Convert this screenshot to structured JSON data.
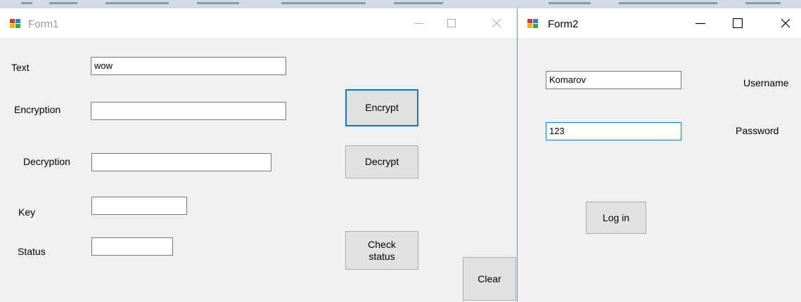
{
  "form1": {
    "title": "Form1",
    "labels": {
      "text": "Text",
      "encryption": "Encryption",
      "decryption": "Decryption",
      "key": "Key",
      "status": "Status"
    },
    "fields": {
      "text": "wow",
      "encryption": "",
      "decryption": "",
      "key": "",
      "status": ""
    },
    "buttons": {
      "encrypt": "Encrypt",
      "decrypt": "Decrypt",
      "check_status": "Check\nstatus",
      "clear": "Clear"
    }
  },
  "form2": {
    "title": "Form2",
    "labels": {
      "username": "Username",
      "password": "Password"
    },
    "fields": {
      "username": "Komarov",
      "password": "123"
    },
    "buttons": {
      "login": "Log in"
    }
  },
  "icons": [
    "app-icon",
    "minimize-icon",
    "maximize-icon",
    "close-icon"
  ],
  "colors": {
    "accent": "#0078d7",
    "form_background": "#f0f0f0",
    "titlebar": "#ffffff",
    "button_face": "#e1e1e1",
    "button_border": "#adadad",
    "inactive_title_text": "#999999"
  }
}
